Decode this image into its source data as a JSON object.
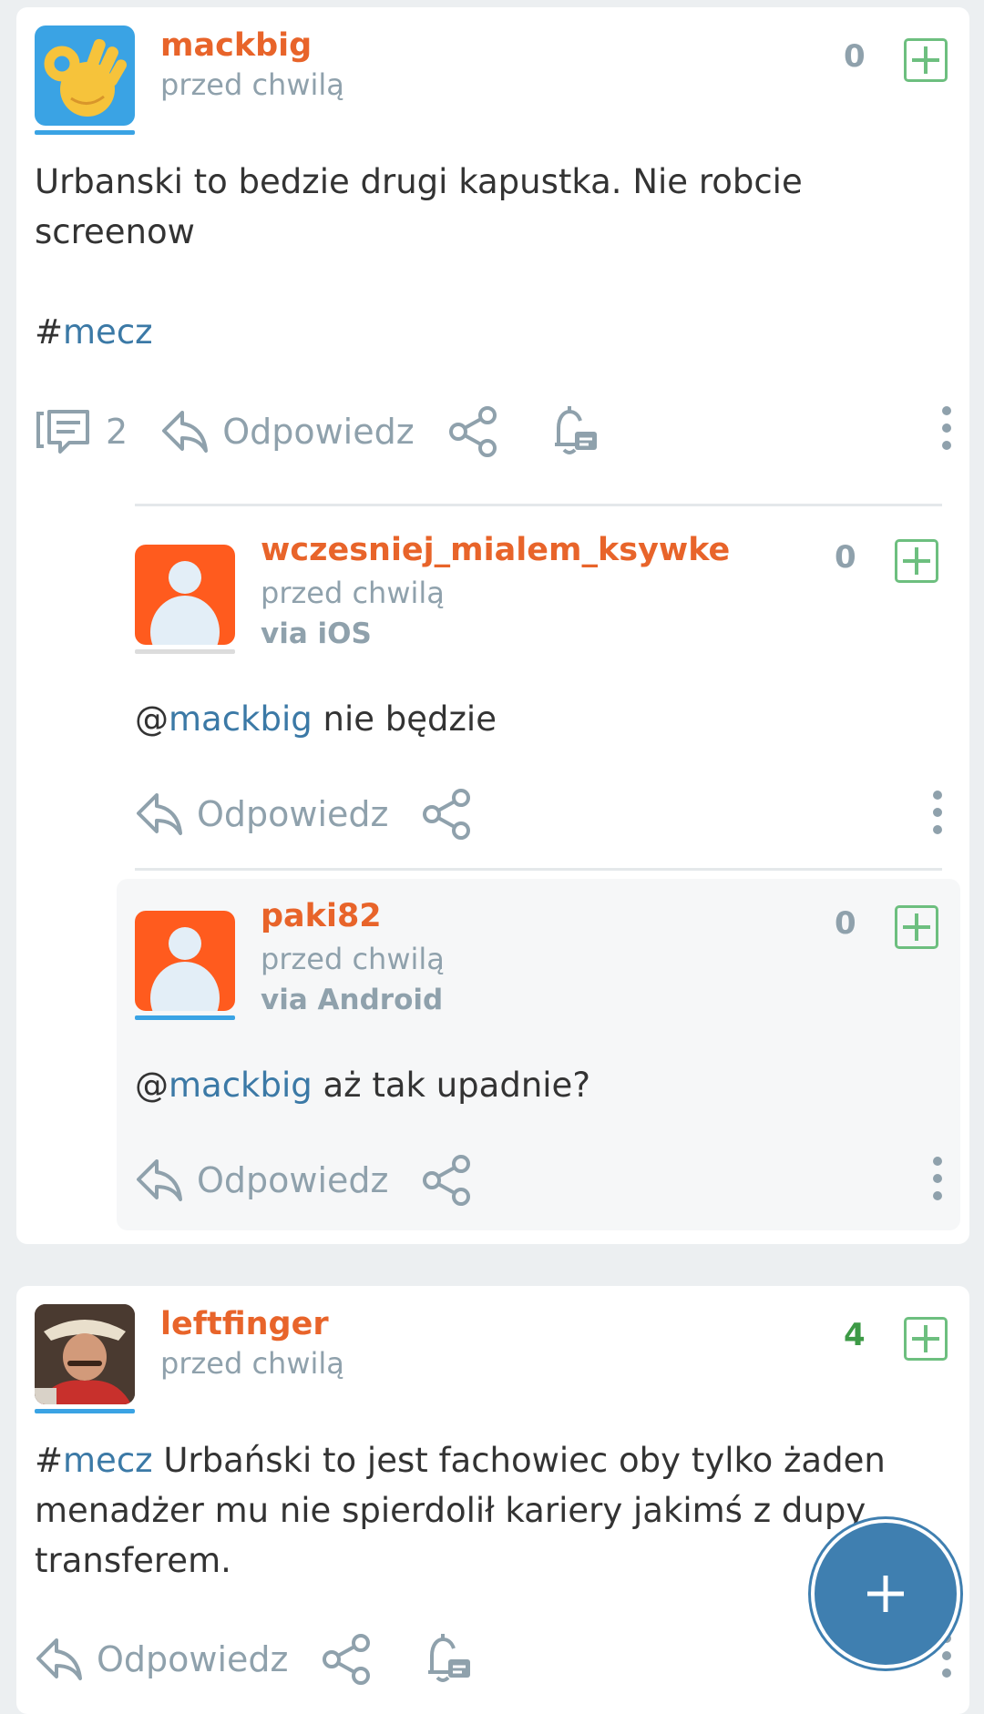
{
  "posts": [
    {
      "username": "mackbig",
      "time": "przed chwilą",
      "score": "0",
      "text_line1": "Urbanski to bedzie drugi kapustka. Nie robcie",
      "text_line2": "screenow",
      "hash": "#",
      "tag": "mecz",
      "comments_count": "2",
      "reply_label": "Odpowiedz",
      "avatar_icon": "ok-hand-emoji",
      "replies": [
        {
          "username": "wczesniej_mialem_ksywke",
          "time": "przed chwilą",
          "via": "via iOS",
          "score": "0",
          "at": "@",
          "mention": "mackbig",
          "text": " nie będzie",
          "reply_label": "Odpowiedz"
        },
        {
          "username": "paki82",
          "time": "przed chwilą",
          "via": "via Android",
          "score": "0",
          "at": "@",
          "mention": "mackbig",
          "text": " aż tak upadnie?",
          "reply_label": "Odpowiedz"
        }
      ]
    },
    {
      "username": "leftfinger",
      "time": "przed chwilą",
      "score": "4",
      "hash": "#",
      "tag": "mecz",
      "text_line1_rest": " Urbański to jest fachowiec oby tylko żaden",
      "text_line2": "menadżer mu nie spierdolił kariery jakimś z dupy",
      "text_line3": "transferem.",
      "reply_label": "Odpowiedz"
    }
  ],
  "colors": {
    "username": "#e8642a",
    "link": "#3b79a6",
    "muted": "#8fa1ac",
    "plus": "#6dbf7f",
    "fab": "#3f7fb0"
  }
}
